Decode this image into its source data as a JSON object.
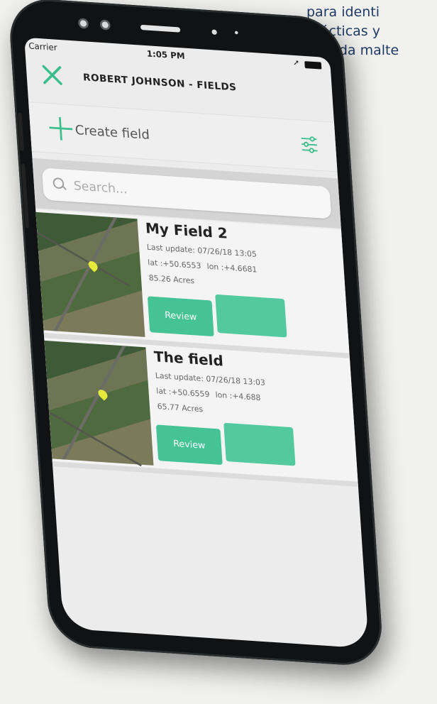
{
  "background_text": {
    "line1": "para identi",
    "line2": "prácticas y",
    "line3": "cebada malte"
  },
  "status_bar": {
    "carrier": "Carrier",
    "time": "1:05 PM"
  },
  "navbar": {
    "title": "ROBERT JOHNSON - FIELDS"
  },
  "create_bar": {
    "label": "Create field"
  },
  "search": {
    "placeholder": "Search..."
  },
  "fields": [
    {
      "name": "My Field 2",
      "last_update": "Last update: 07/26/18 13:05",
      "lat": "lat :+50.6553",
      "lon": "lon :+4.6681",
      "acres": "85.26 Acres",
      "review_label": "Review"
    },
    {
      "name": "The field",
      "last_update": "Last update: 07/26/18 13:03",
      "lat": "lat :+50.6559",
      "lon": "lon :+4.688",
      "acres": "65.77 Acres",
      "review_label": "Review"
    }
  ],
  "colors": {
    "accent": "#45c397",
    "title_text": "#222222"
  }
}
